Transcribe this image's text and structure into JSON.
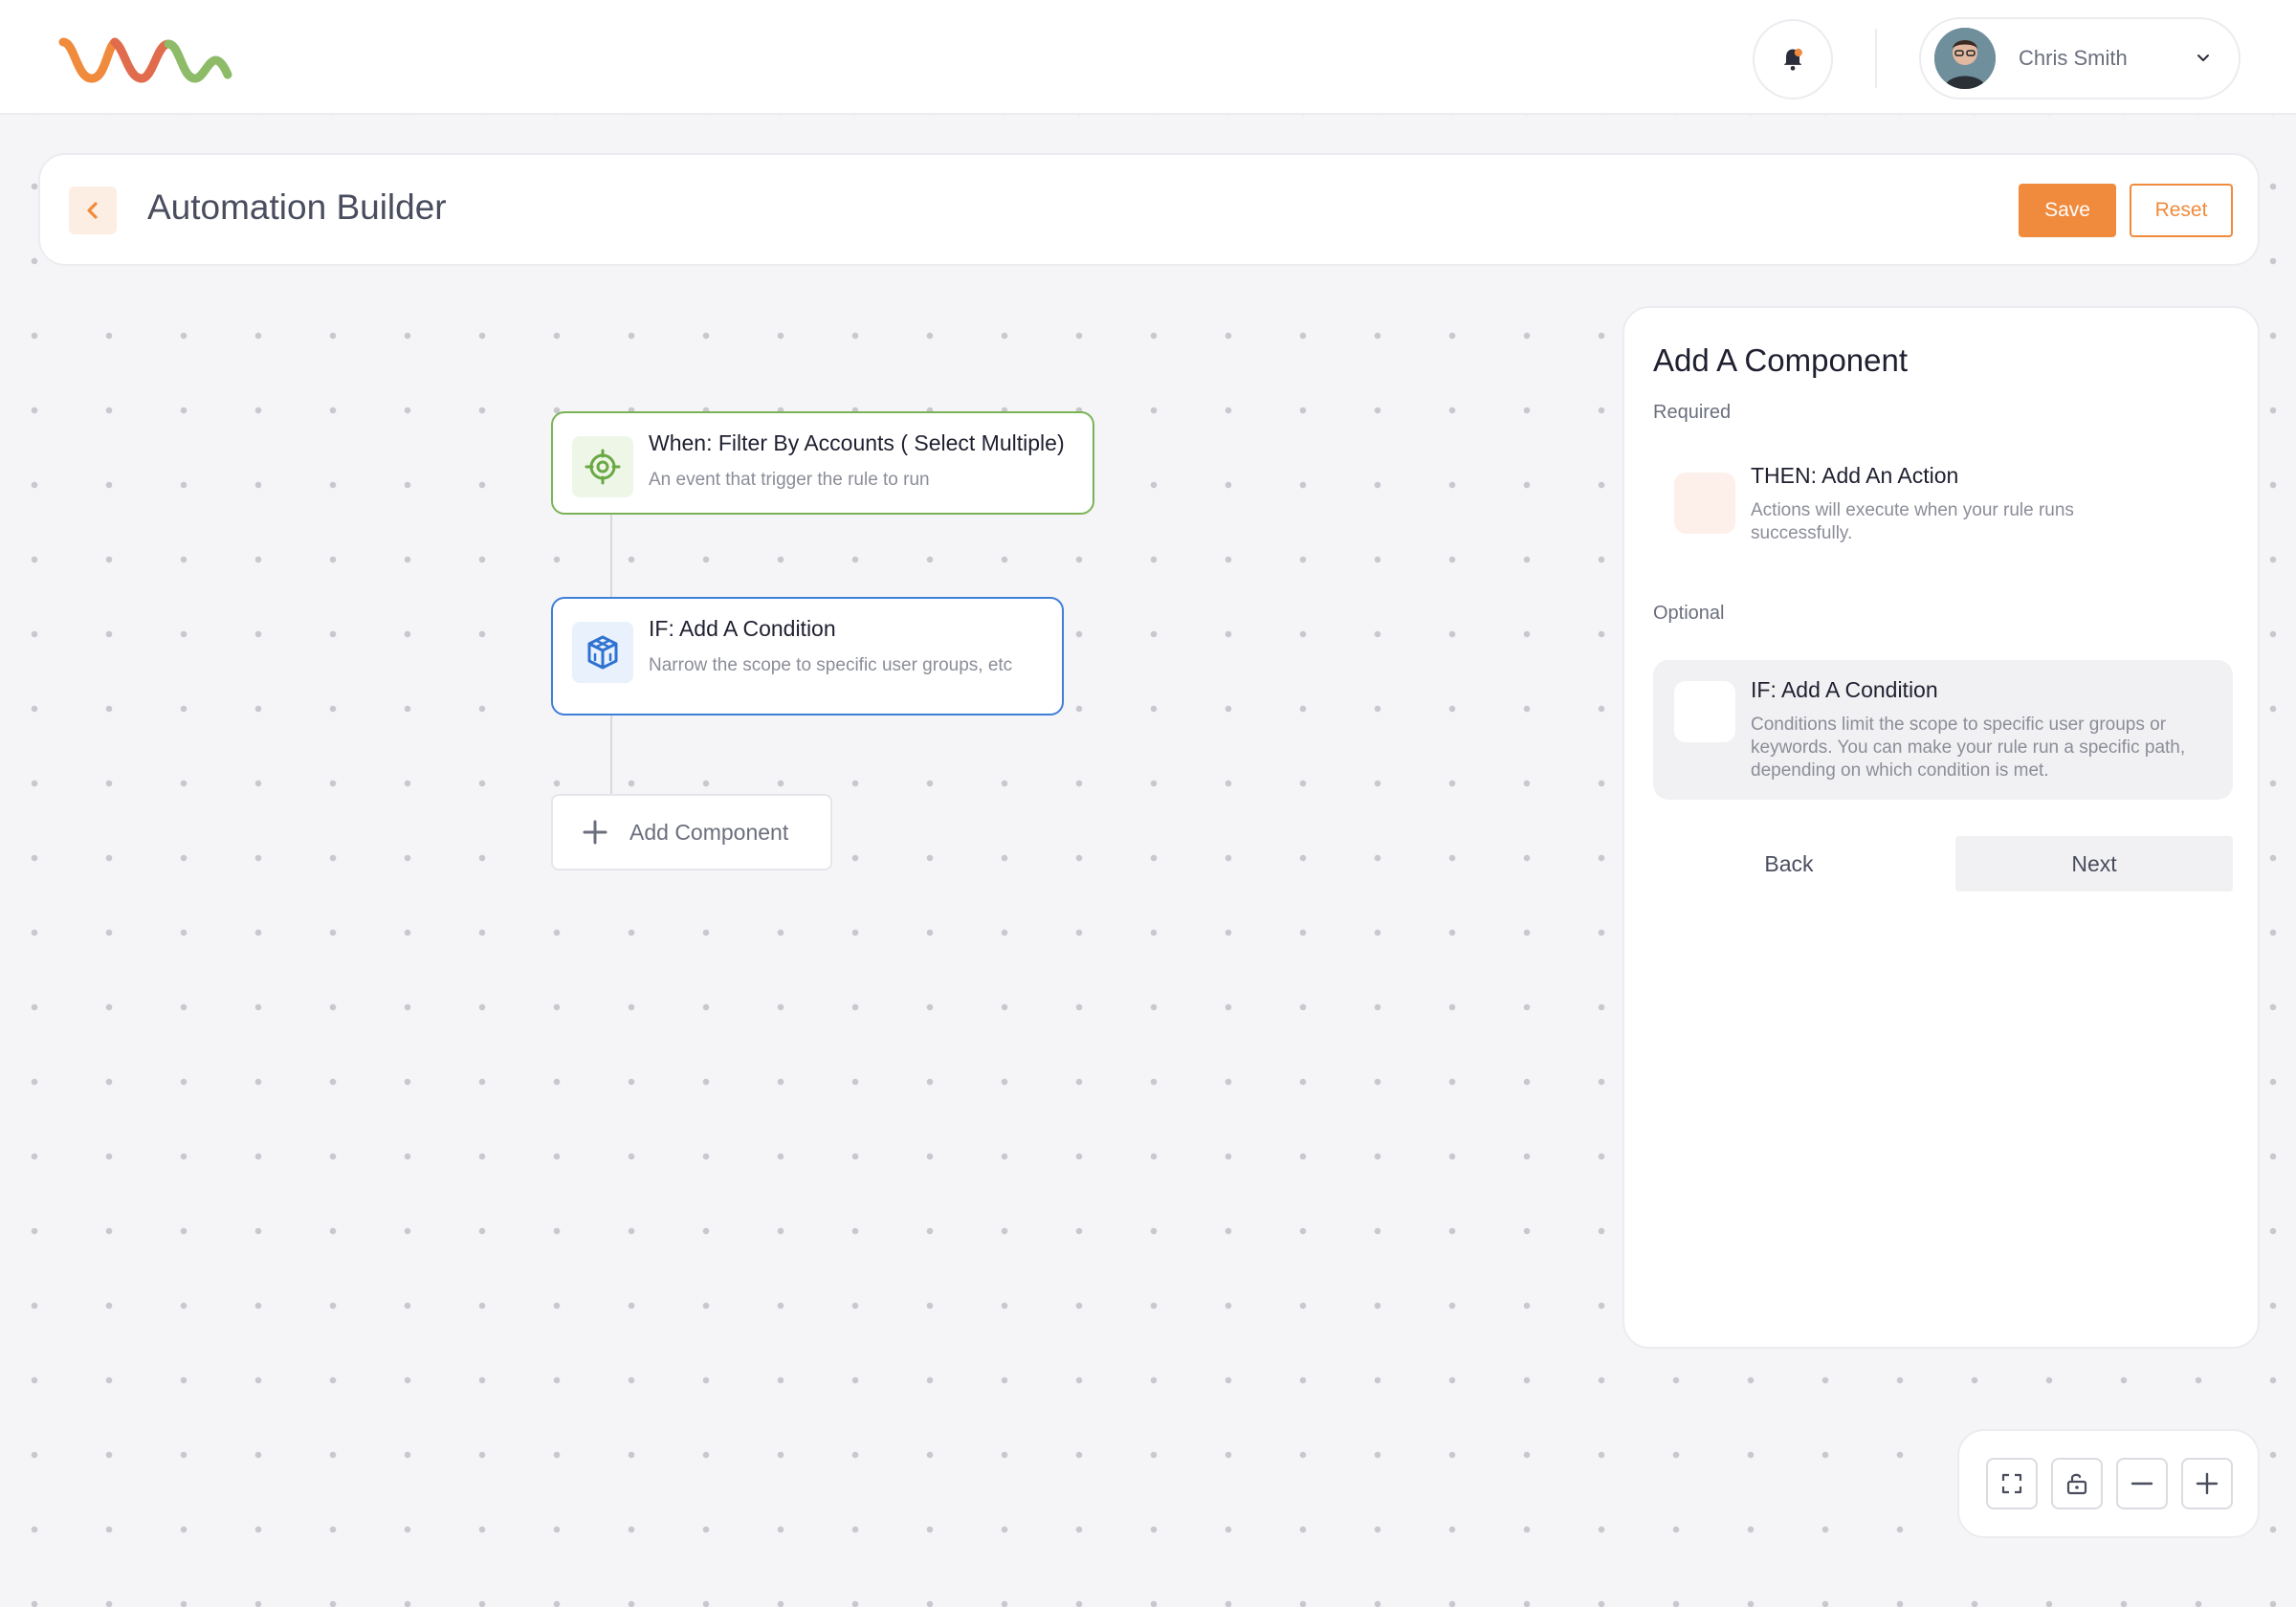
{
  "header": {
    "user_name": "Chris Smith"
  },
  "toolbar": {
    "title": "Automation Builder",
    "save_label": "Save",
    "reset_label": "Reset"
  },
  "canvas": {
    "trigger": {
      "title": "When: Filter By Accounts ( Select Multiple)",
      "description": "An event that trigger the rule to run"
    },
    "condition": {
      "title": "IF: Add A Condition",
      "description": "Narrow the scope to specific user groups, etc"
    },
    "add_component_label": "Add Component"
  },
  "panel": {
    "title": "Add A Component",
    "required_label": "Required",
    "optional_label": "Optional",
    "options": [
      {
        "title": "THEN: Add An Action",
        "description": "Actions will execute when your rule runs successfully."
      },
      {
        "title": "IF: Add A Condition",
        "description": "Conditions limit the scope to specific user groups or keywords. You can make your rule run a specific path, depending on which condition is met."
      }
    ],
    "back_label": "Back",
    "next_label": "Next"
  },
  "colors": {
    "accent": "#f08a3c",
    "trigger_border": "#7ab356",
    "condition_border": "#3f7fd6"
  },
  "icons": {
    "logo": "wave-logo",
    "notifications": "bell-icon",
    "user_menu": "chevron-down-icon",
    "back": "chevron-left-icon",
    "trigger": "target-icon",
    "condition": "cube-icon",
    "add": "plus-icon",
    "controls": [
      "fullscreen-icon",
      "unlock-icon",
      "zoom-out-icon",
      "zoom-in-icon"
    ]
  }
}
